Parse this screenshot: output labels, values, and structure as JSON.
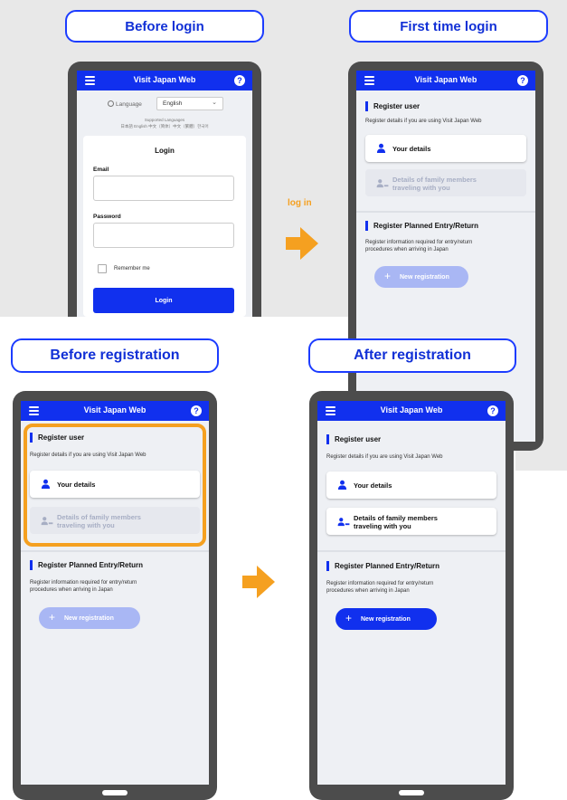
{
  "captions": {
    "before_login": "Before login",
    "first_time_login": "First time login",
    "before_registration": "Before registration",
    "after_registration": "After registration"
  },
  "arrow_label": "log in",
  "app": {
    "title": "Visit Japan Web",
    "help_glyph": "?",
    "menu_icon": "hamburger-menu-icon",
    "help_icon": "question-circle-icon"
  },
  "login_screen": {
    "language_label": "Language",
    "language_value": "English",
    "supported_title": "Supported Languages",
    "supported_list": "日本語 English 中文（简体）中文（繁體）한국어",
    "card_title": "Login",
    "email_label": "Email",
    "password_label": "Password",
    "remember_label": "Remember me",
    "login_button": "Login"
  },
  "registration": {
    "register_user_title": "Register user",
    "register_user_desc": "Register details if you are using Visit Japan Web",
    "your_details": "Your details",
    "family_line1": "Details of family members",
    "family_line2": "traveling with you",
    "planned_title": "Register Planned Entry/Return",
    "planned_desc_line1": "Register information required for entry/return",
    "planned_desc_line2": "procedures when arriving in Japan",
    "new_registration": "New registration"
  },
  "colors": {
    "brand_blue": "#1130ee",
    "caption_blue": "#1130d6",
    "highlight_orange": "#f5a020",
    "phone_frame": "#4c4c4c",
    "backdrop_gray": "#e8e8e8"
  }
}
